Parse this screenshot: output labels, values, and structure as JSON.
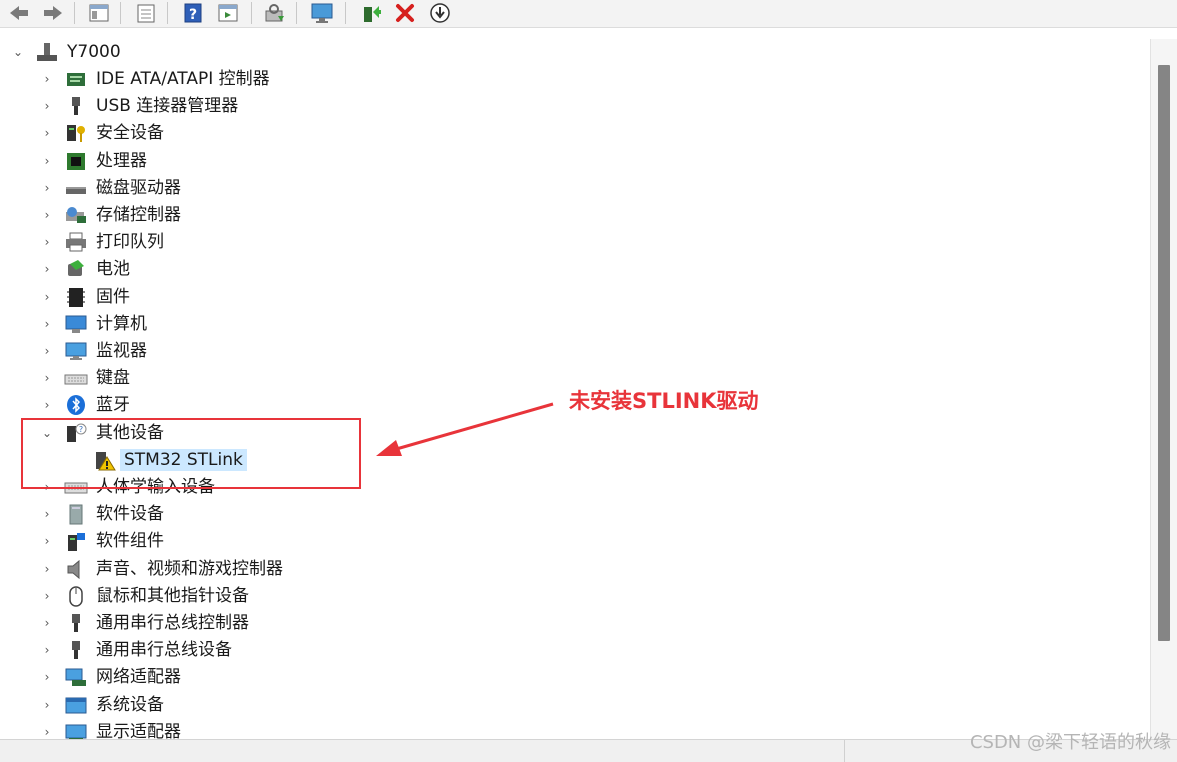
{
  "toolbar": {
    "icons": [
      "back-arrow-icon",
      "forward-arrow-icon",
      "console-tree-icon",
      "properties-icon",
      "help-icon",
      "action-pane-icon",
      "scan-hardware-icon",
      "monitor-icon",
      "update-driver-icon",
      "uninstall-icon",
      "disable-device-icon"
    ]
  },
  "tree": {
    "root": {
      "label": "Y7000"
    },
    "categories": [
      {
        "label": "IDE ATA/ATAPI 控制器",
        "icon": "ide-controller-icon",
        "expanded": false
      },
      {
        "label": "USB 连接器管理器",
        "icon": "usb-plug-icon",
        "expanded": false
      },
      {
        "label": "安全设备",
        "icon": "security-key-icon",
        "expanded": false
      },
      {
        "label": "处理器",
        "icon": "processor-icon",
        "expanded": false
      },
      {
        "label": "磁盘驱动器",
        "icon": "disk-drive-icon",
        "expanded": false
      },
      {
        "label": "存储控制器",
        "icon": "storage-controller-icon",
        "expanded": false
      },
      {
        "label": "打印队列",
        "icon": "printer-icon",
        "expanded": false
      },
      {
        "label": "电池",
        "icon": "battery-icon",
        "expanded": false
      },
      {
        "label": "固件",
        "icon": "firmware-icon",
        "expanded": false
      },
      {
        "label": "计算机",
        "icon": "computer-icon",
        "expanded": false
      },
      {
        "label": "监视器",
        "icon": "monitor-icon",
        "expanded": false
      },
      {
        "label": "键盘",
        "icon": "keyboard-icon",
        "expanded": false
      },
      {
        "label": "蓝牙",
        "icon": "bluetooth-icon",
        "expanded": false
      },
      {
        "label": "其他设备",
        "icon": "other-devices-icon",
        "expanded": true,
        "children": [
          {
            "label": "STM32 STLink",
            "icon": "warning-device-icon",
            "selected": true
          }
        ]
      },
      {
        "label": "人体学输入设备",
        "icon": "hid-icon",
        "expanded": false
      },
      {
        "label": "软件设备",
        "icon": "software-device-icon",
        "expanded": false
      },
      {
        "label": "软件组件",
        "icon": "software-component-icon",
        "expanded": false
      },
      {
        "label": "声音、视频和游戏控制器",
        "icon": "speaker-icon",
        "expanded": false
      },
      {
        "label": "鼠标和其他指针设备",
        "icon": "mouse-icon",
        "expanded": false
      },
      {
        "label": "通用串行总线控制器",
        "icon": "usb-plug-icon",
        "expanded": false
      },
      {
        "label": "通用串行总线设备",
        "icon": "usb-plug-icon",
        "expanded": false
      },
      {
        "label": "网络适配器",
        "icon": "network-adapter-icon",
        "expanded": false
      },
      {
        "label": "系统设备",
        "icon": "system-devices-icon",
        "expanded": false
      },
      {
        "label": "显示适配器",
        "icon": "display-adapter-icon",
        "expanded": false
      }
    ]
  },
  "annotation": {
    "text": "未安装STLINK驱动",
    "color": "#e8343a"
  },
  "watermark": "CSDN @梁下轻语的秋缘"
}
